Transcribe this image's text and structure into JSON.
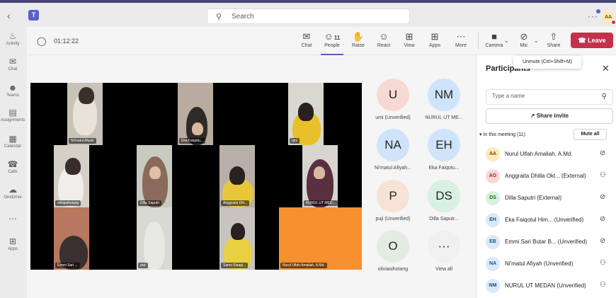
{
  "titlebar": {
    "search_placeholder": "Search",
    "more": "···",
    "user_initials": "AA"
  },
  "rail": {
    "items": [
      {
        "label": "Activity",
        "icon": "bell-icon"
      },
      {
        "label": "Chat",
        "icon": "chat-icon"
      },
      {
        "label": "Teams",
        "icon": "teams-icon"
      },
      {
        "label": "Assignments",
        "icon": "assignments-icon"
      },
      {
        "label": "Calendar",
        "icon": "calendar-icon"
      },
      {
        "label": "Calls",
        "icon": "phone-icon"
      },
      {
        "label": "OneDrive",
        "icon": "cloud-icon"
      },
      {
        "label": "",
        "icon": "more-icon"
      },
      {
        "label": "Apps",
        "icon": "add-icon"
      }
    ]
  },
  "toolbar": {
    "timer": "01:12:22",
    "chat": "Chat",
    "people": "People",
    "people_count": "11",
    "raise": "Raise",
    "react": "React",
    "view": "View",
    "apps": "Apps",
    "more": "More",
    "camera": "Camera",
    "mic": "Mic",
    "share": "Share",
    "leave": "Leave"
  },
  "tooltip": "Unmute (Ctrl+Shift+M)",
  "stage": {
    "tiles": [
      {
        "name": "Ni'matul Afiyah"
      },
      {
        "name": "Eka Faiqotu..."
      },
      {
        "name": "umi"
      },
      {
        "name": "oliviasihotang"
      },
      {
        "name": "Dilla Saputri"
      },
      {
        "name": "Anggraita Dhi..."
      },
      {
        "name": "NURUL UT MED..."
      },
      {
        "name": "Emmi Sari ..."
      },
      {
        "name": "puji"
      },
      {
        "name": "Sanni Siaagi..."
      },
      {
        "name": "Nurul Ulfah Amaliah, A.Md."
      }
    ]
  },
  "gallery": [
    {
      "initials": "U",
      "name": "umi (Unverified)",
      "color": "#f7d9d4"
    },
    {
      "initials": "NM",
      "name": "NURUL UT ME...",
      "color": "#cfe4fa"
    },
    {
      "initials": "NA",
      "name": "Ni'matul Afiyah...",
      "color": "#cfe4fa"
    },
    {
      "initials": "EH",
      "name": "Eka Faiqotu...",
      "color": "#cfe4fa"
    },
    {
      "initials": "P",
      "name": "puji (Unverified)",
      "color": "#f6e3d6"
    },
    {
      "initials": "DS",
      "name": "Dilla Saputr...",
      "color": "#d7f0e1"
    },
    {
      "initials": "O",
      "name": "oliviasihotang",
      "color": "#e3ece1"
    },
    {
      "initials": "···",
      "name": "View all",
      "color": "#f0f0f0"
    }
  ],
  "panel": {
    "title": "Participants",
    "search_placeholder": "Type a name",
    "share_invite": "Share invite",
    "in_meeting": "In this meeting (11)",
    "mute_all": "Mute all",
    "participants": [
      {
        "initials": "AA",
        "name": "Nurul Ulfah Amaliah, A.Md.",
        "color": "#fde9b9",
        "text": "#6a4b00",
        "mic": "muted"
      },
      {
        "initials": "AO",
        "name": "Anggraita Dhilla Okt... (External)",
        "color": "#f7d9d4",
        "text": "#a4262c",
        "mic": "on"
      },
      {
        "initials": "DS",
        "name": "Dilla Saputri (External)",
        "color": "#d7f0e1",
        "text": "#0e700e",
        "mic": "muted"
      },
      {
        "initials": "EH",
        "name": "Eka Faiqotul Him...  (Unverified)",
        "color": "#dbe8f7",
        "text": "#0f548c",
        "mic": "muted"
      },
      {
        "initials": "EB",
        "name": "Emmi Sari Butar B...  (Unverified)",
        "color": "#dbe8f7",
        "text": "#0f548c",
        "mic": "muted"
      },
      {
        "initials": "NA",
        "name": "Ni'matul Afiyah (Unverified)",
        "color": "#dbe8f7",
        "text": "#0f548c",
        "mic": "on"
      },
      {
        "initials": "NM",
        "name": "NURUL UT MEDAN (Unverified)",
        "color": "#dbe8f7",
        "text": "#0f548c",
        "mic": "on"
      }
    ]
  }
}
